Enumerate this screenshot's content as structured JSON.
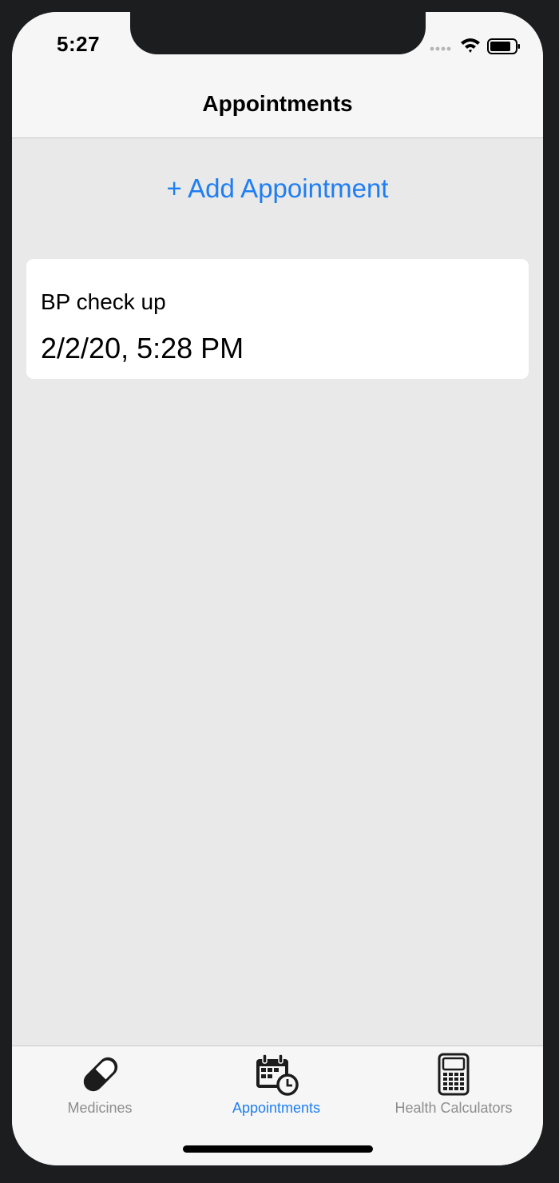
{
  "status_bar": {
    "time": "5:27"
  },
  "nav": {
    "title": "Appointments"
  },
  "actions": {
    "add_label": "+ Add Appointment"
  },
  "appointments": [
    {
      "title": "BP check up",
      "datetime": "2/2/20, 5:28 PM"
    }
  ],
  "tabs": [
    {
      "label": "Medicines",
      "icon": "pill-icon",
      "active": false
    },
    {
      "label": "Appointments",
      "icon": "calendar-clock-icon",
      "active": true
    },
    {
      "label": "Health Calculators",
      "icon": "calculator-icon",
      "active": false
    }
  ],
  "colors": {
    "accent": "#1e7ef3",
    "inactive_tab": "#8e8e8e",
    "background": "#e9e9e9",
    "bar_background": "#f6f6f6"
  }
}
